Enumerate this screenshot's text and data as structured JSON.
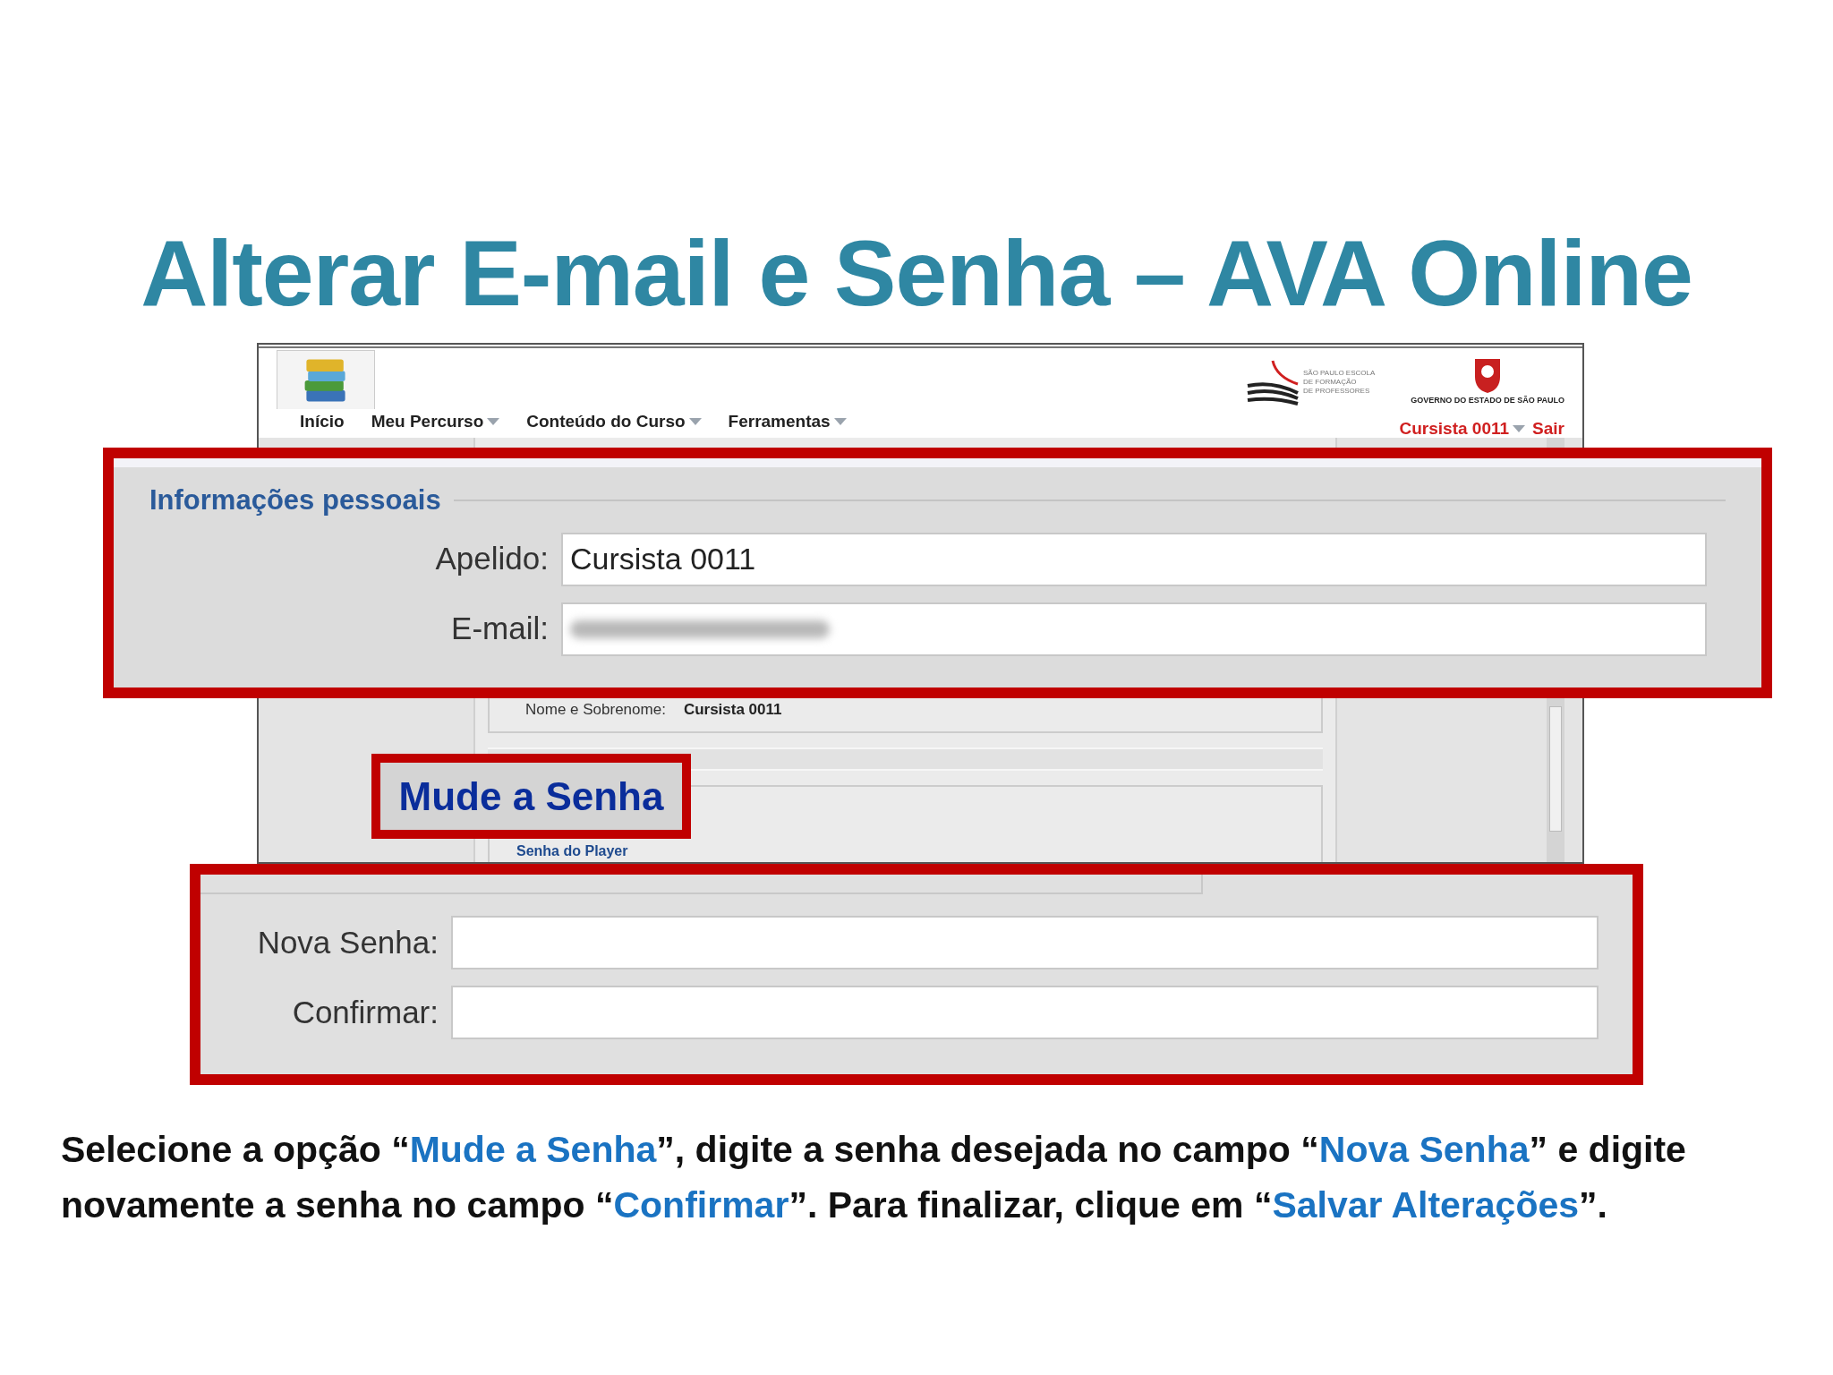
{
  "title": "Alterar E-mail e Senha – AVA Online",
  "app": {
    "nav": [
      {
        "label": "Início",
        "dropdown": false
      },
      {
        "label": "Meu Percurso",
        "dropdown": true
      },
      {
        "label": "Conteúdo do Curso",
        "dropdown": true
      },
      {
        "label": "Ferramentas",
        "dropdown": true
      }
    ],
    "school_logo": [
      "SÃO PAULO ESCOLA",
      "DE FORMAÇÃO",
      "DE PROFESSORES"
    ],
    "government": "GOVERNO DO ESTADO DE SÃO PAULO",
    "user": "Cursista 0011",
    "logout": "Sair",
    "name_label": "Nome e Sobrenome:",
    "name_value": "Cursista 0011",
    "player_legend": "Senha do Player"
  },
  "personal": {
    "legend": "Informações pessoais",
    "fields": [
      {
        "label": "Apelido:",
        "value": "Cursista 0011",
        "blurred": false
      },
      {
        "label": "E-mail:",
        "blurred": true
      }
    ]
  },
  "change_password": {
    "label": "Mude a Senha"
  },
  "password": {
    "fields": [
      {
        "label": "Nova Senha:"
      },
      {
        "label": "Confirmar:"
      }
    ]
  },
  "instructions": [
    {
      "text": "Selecione a opção “",
      "highlight": false
    },
    {
      "text": "Mude a Senha",
      "highlight": true
    },
    {
      "text": "”, digite a senha desejada no campo “",
      "highlight": false
    },
    {
      "text": "Nova Senha",
      "highlight": true
    },
    {
      "text": "” e digite novamente a senha no campo “",
      "highlight": false
    },
    {
      "text": "Confirmar",
      "highlight": true
    },
    {
      "text": "”. Para finalizar, clique em “",
      "highlight": false
    },
    {
      "text": "Salvar Alterações",
      "highlight": true
    },
    {
      "text": "”.",
      "highlight": false
    }
  ]
}
